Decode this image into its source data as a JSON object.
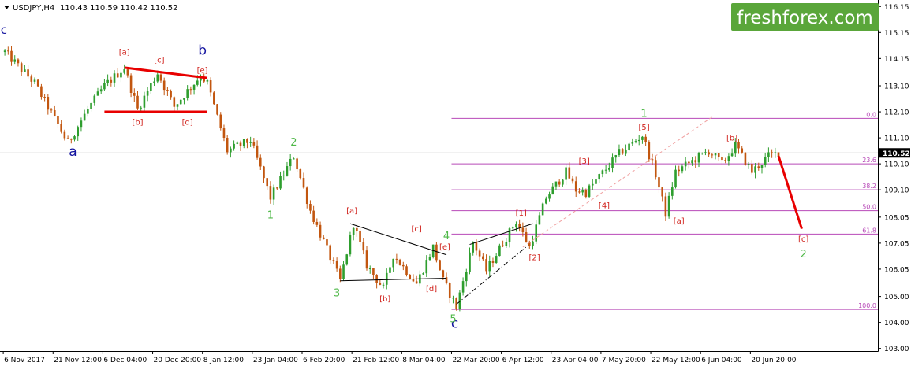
{
  "header": {
    "symbol": "USDJPY,H4",
    "ohlc": "110.43 110.59 110.42 110.52"
  },
  "logo": {
    "text": "freshforex.com",
    "bg": "#5aa63a",
    "fg": "#ffffff"
  },
  "colors": {
    "candle_up": "#2e9e2e",
    "candle_down": "#c2560f",
    "red_label": "#d0211b",
    "green_label": "#4fb848",
    "blue_label": "#1515a0",
    "fib": "#b84ab8",
    "red_line": "#e80000",
    "axis": "#000000",
    "grid": "#c8c8c8"
  },
  "chart_data": {
    "type": "candlestick",
    "ylim": [
      102.9,
      116.4
    ],
    "yticks": [
      "116.15",
      "115.15",
      "114.15",
      "113.10",
      "112.10",
      "111.10",
      "110.10",
      "109.10",
      "108.05",
      "107.05",
      "106.05",
      "105.00",
      "104.00",
      "103.00"
    ],
    "current_price": {
      "value": 110.52,
      "label": "110.52"
    },
    "x_labels": [
      "6 Nov 2017",
      "21 Nov 12:00",
      "6 Dec 04:00",
      "20 Dec 20:00",
      "8 Jan 12:00",
      "23 Jan 04:00",
      "6 Feb 20:00",
      "21 Feb 12:00",
      "8 Mar 04:00",
      "22 Mar 20:00",
      "6 Apr 12:00",
      "23 Apr 04:00",
      "7 May 20:00",
      "22 May 12:00",
      "6 Jun 04:00",
      "20 Jun 20:00"
    ],
    "x_label_index": [
      0,
      15,
      30,
      45,
      60,
      75,
      90,
      105,
      120,
      135,
      150,
      165,
      180,
      195,
      210,
      225
    ],
    "n_bars": 234,
    "path_keypoints": [
      [
        0,
        114.4
      ],
      [
        9,
        113.2
      ],
      [
        19,
        110.9
      ],
      [
        25,
        112.2
      ],
      [
        30,
        113.1
      ],
      [
        36,
        113.8
      ],
      [
        40,
        112.2
      ],
      [
        46,
        113.6
      ],
      [
        51,
        112.3
      ],
      [
        55,
        112.9
      ],
      [
        59,
        113.5
      ],
      [
        61,
        113.2
      ],
      [
        67,
        110.6
      ],
      [
        74,
        111.0
      ],
      [
        80,
        108.8
      ],
      [
        87,
        110.4
      ],
      [
        92,
        108.3
      ],
      [
        97,
        106.8
      ],
      [
        101,
        105.6
      ],
      [
        105,
        107.8
      ],
      [
        109,
        106.2
      ],
      [
        114,
        105.3
      ],
      [
        117,
        106.6
      ],
      [
        124,
        105.5
      ],
      [
        129,
        106.9
      ],
      [
        132,
        105.6
      ],
      [
        136,
        104.6
      ],
      [
        141,
        107.1
      ],
      [
        145,
        106.0
      ],
      [
        154,
        107.9
      ],
      [
        158,
        106.9
      ],
      [
        163,
        108.8
      ],
      [
        169,
        109.8
      ],
      [
        172,
        109.1
      ],
      [
        175,
        109.0
      ],
      [
        185,
        110.5
      ],
      [
        192,
        111.2
      ],
      [
        196,
        109.7
      ],
      [
        199,
        108.2
      ],
      [
        202,
        109.8
      ],
      [
        212,
        110.6
      ],
      [
        216,
        110.1
      ],
      [
        220,
        110.8
      ],
      [
        225,
        109.8
      ],
      [
        230,
        110.4
      ],
      [
        233,
        110.52
      ]
    ],
    "fib_levels": [
      {
        "label": "0.0",
        "value": 111.85
      },
      {
        "label": "23.6",
        "value": 110.1
      },
      {
        "label": "38.2",
        "value": 109.1
      },
      {
        "label": "50.0",
        "value": 108.3
      },
      {
        "label": "61.8",
        "value": 107.4
      },
      {
        "label": "100.0",
        "value": 104.5
      }
    ],
    "fib_x_start_index": 135,
    "trend_lines": [
      {
        "style": "red",
        "points": [
          [
            36,
            113.8
          ],
          [
            61,
            113.4
          ]
        ]
      },
      {
        "style": "red",
        "points": [
          [
            30,
            112.1
          ],
          [
            61,
            112.1
          ]
        ]
      },
      {
        "style": "black",
        "points": [
          [
            104,
            107.8
          ],
          [
            133,
            106.6
          ]
        ]
      },
      {
        "style": "black",
        "points": [
          [
            101,
            105.6
          ],
          [
            133,
            105.7
          ]
        ]
      },
      {
        "style": "black",
        "points": [
          [
            140,
            107.0
          ],
          [
            159,
            107.8
          ]
        ]
      },
      {
        "style": "dashdot",
        "points": [
          [
            136,
            104.7
          ],
          [
            157,
            106.9
          ]
        ]
      },
      {
        "style": "pinkdash",
        "points": [
          [
            156,
            106.9
          ],
          [
            213,
            111.9
          ]
        ]
      },
      {
        "style": "redbold",
        "points": [
          [
            233,
            110.4
          ],
          [
            240,
            107.6
          ]
        ]
      }
    ],
    "wave_labels": [
      {
        "text": "a",
        "x": 20.5,
        "y": 110.4,
        "color": "blue",
        "size": 17
      },
      {
        "text": "b",
        "x": 59.5,
        "y": 114.3,
        "color": "blue",
        "size": 17
      },
      {
        "text": "c",
        "x": 135.5,
        "y": 103.8,
        "color": "blue",
        "size": 17
      },
      {
        "text": "c",
        "x": -0.3,
        "y": 115.1,
        "color": "blue",
        "size": 15
      },
      {
        "text": "[a]",
        "x": 36,
        "y": 114.3,
        "color": "red",
        "size": 10
      },
      {
        "text": "[c]",
        "x": 46.5,
        "y": 114.0,
        "color": "red",
        "size": 10
      },
      {
        "text": "[e]",
        "x": 59.5,
        "y": 113.6,
        "color": "red",
        "size": 10
      },
      {
        "text": "[b]",
        "x": 40,
        "y": 111.6,
        "color": "red",
        "size": 10
      },
      {
        "text": "[d]",
        "x": 55,
        "y": 111.6,
        "color": "red",
        "size": 10
      },
      {
        "text": "2",
        "x": 87,
        "y": 110.8,
        "color": "green",
        "size": 13
      },
      {
        "text": "1",
        "x": 80,
        "y": 108.0,
        "color": "green",
        "size": 13
      },
      {
        "text": "3",
        "x": 100,
        "y": 105.0,
        "color": "green",
        "size": 13
      },
      {
        "text": "4",
        "x": 133,
        "y": 107.2,
        "color": "green",
        "size": 13
      },
      {
        "text": "5",
        "x": 135,
        "y": 104.0,
        "color": "green",
        "size": 13
      },
      {
        "text": "[a]",
        "x": 104.5,
        "y": 108.2,
        "color": "red",
        "size": 10
      },
      {
        "text": "[c]",
        "x": 124,
        "y": 107.5,
        "color": "red",
        "size": 10
      },
      {
        "text": "[e]",
        "x": 132.5,
        "y": 106.8,
        "color": "red",
        "size": 10
      },
      {
        "text": "[b]",
        "x": 114.5,
        "y": 104.8,
        "color": "red",
        "size": 10
      },
      {
        "text": "[d]",
        "x": 128.5,
        "y": 105.2,
        "color": "red",
        "size": 10
      },
      {
        "text": "[1]",
        "x": 155.5,
        "y": 108.1,
        "color": "red",
        "size": 10
      },
      {
        "text": "[2]",
        "x": 159.5,
        "y": 106.4,
        "color": "red",
        "size": 10
      },
      {
        "text": "[3]",
        "x": 174.5,
        "y": 110.1,
        "color": "red",
        "size": 10
      },
      {
        "text": "[4]",
        "x": 180.5,
        "y": 108.4,
        "color": "red",
        "size": 10
      },
      {
        "text": "1",
        "x": 192.5,
        "y": 111.9,
        "color": "green",
        "size": 13
      },
      {
        "text": "[5]",
        "x": 192.5,
        "y": 111.4,
        "color": "red",
        "size": 10
      },
      {
        "text": "[a]",
        "x": 203,
        "y": 107.8,
        "color": "red",
        "size": 10
      },
      {
        "text": "[b]",
        "x": 219,
        "y": 111.0,
        "color": "red",
        "size": 10
      },
      {
        "text": "[c]",
        "x": 240.5,
        "y": 107.1,
        "color": "red",
        "size": 10
      },
      {
        "text": "2",
        "x": 240.5,
        "y": 106.5,
        "color": "green",
        "size": 13
      }
    ]
  }
}
